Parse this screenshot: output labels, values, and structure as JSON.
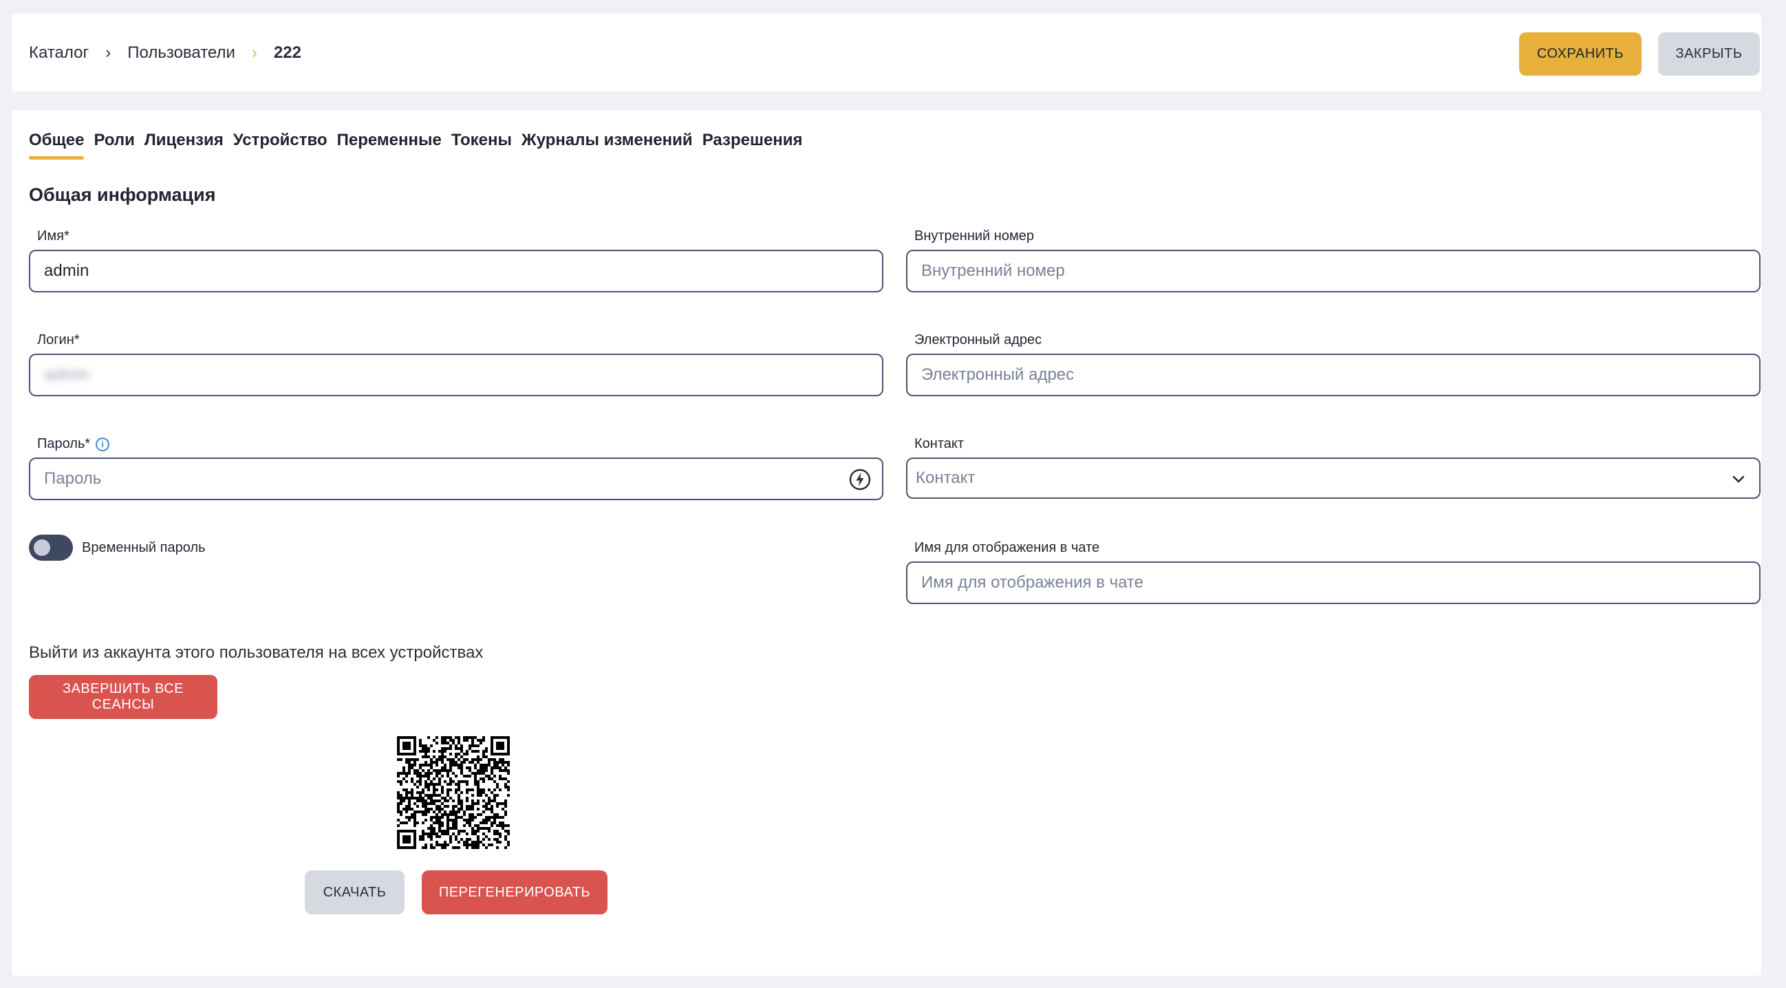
{
  "breadcrumb": {
    "items": [
      "Каталог",
      "Пользователи"
    ],
    "current": "222"
  },
  "header": {
    "save_label": "Сохранить",
    "close_label": "Закрыть"
  },
  "tabs": [
    {
      "label": "Общее",
      "active": true
    },
    {
      "label": "Роли"
    },
    {
      "label": "Лицензия"
    },
    {
      "label": "Устройство"
    },
    {
      "label": "Переменные"
    },
    {
      "label": "Токены"
    },
    {
      "label": "Журналы изменений"
    },
    {
      "label": "Разрешения"
    }
  ],
  "section_title": "Общая информация",
  "fields": {
    "name": {
      "label": "Имя*",
      "value": "admin"
    },
    "login": {
      "label": "Логин*",
      "value": "admin"
    },
    "password": {
      "label": "Пароль*",
      "placeholder": "Пароль"
    },
    "internal_number": {
      "label": "Внутренний номер",
      "placeholder": "Внутренний номер"
    },
    "email": {
      "label": "Электронный адрес",
      "placeholder": "Электронный адрес"
    },
    "contact": {
      "label": "Контакт",
      "placeholder": "Контакт"
    },
    "chat_name": {
      "label": "Имя для отображения в чате",
      "placeholder": "Имя для отображения в чате"
    }
  },
  "temp_password": {
    "label": "Временный пароль",
    "enabled": false
  },
  "sessions": {
    "text": "Выйти из аккаунта этого пользователя на всех устройствах",
    "button": "Завершить все сеансы"
  },
  "qr": {
    "download_label": "Скачать",
    "regenerate_label": "Перегенерировать"
  },
  "colors": {
    "accent": "#e6b03a",
    "danger": "#d9534f",
    "neutral_button": "#d7d9e1",
    "border": "#4a5370"
  }
}
